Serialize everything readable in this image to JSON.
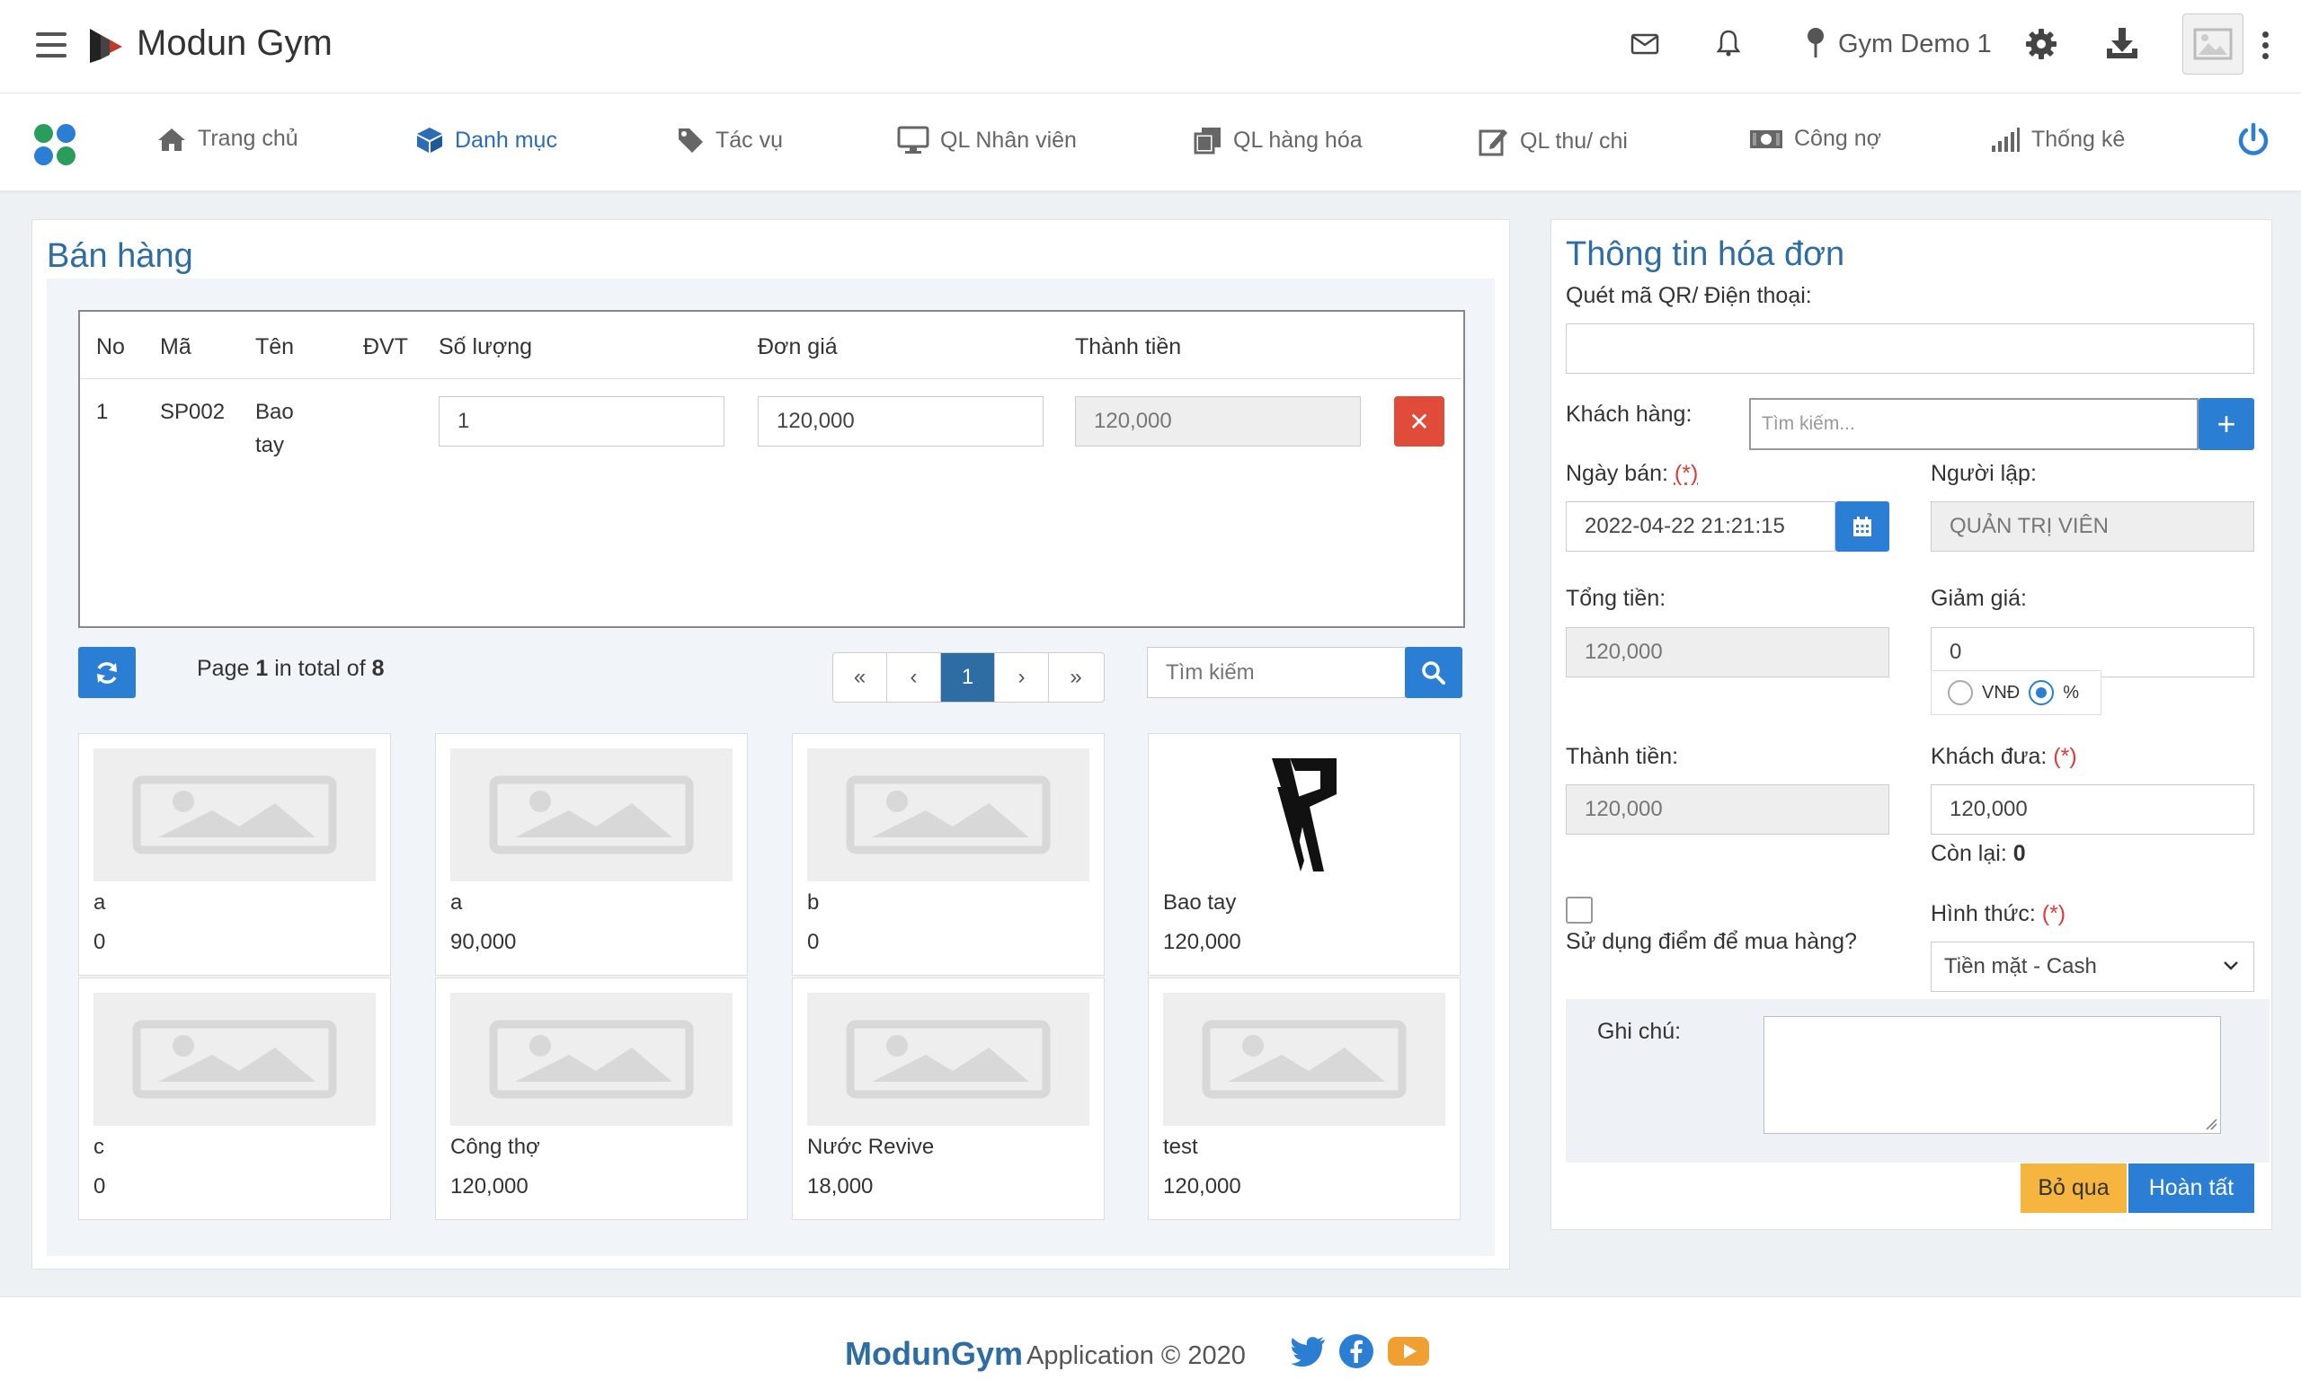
{
  "header": {
    "brand": "Modun Gym",
    "location": "Gym Demo 1"
  },
  "nav": [
    {
      "label": "Trang chủ",
      "icon": "home-icon"
    },
    {
      "label": "Danh mục",
      "icon": "cube-icon",
      "active": true
    },
    {
      "label": "Tác vụ",
      "icon": "tag-icon"
    },
    {
      "label": "QL Nhân viên",
      "icon": "monitor-icon"
    },
    {
      "label": "QL hàng hóa",
      "icon": "copy-icon"
    },
    {
      "label": "QL thu/ chi",
      "icon": "edit-icon"
    },
    {
      "label": "Công nợ",
      "icon": "money-icon"
    },
    {
      "label": "Thống kê",
      "icon": "signal-bars-icon"
    }
  ],
  "sales": {
    "title": "Bán hàng",
    "columns": [
      "No",
      "Mã",
      "Tên",
      "ĐVT",
      "Số lượng",
      "Đơn giá",
      "Thành tiền"
    ],
    "rows": [
      {
        "no": "1",
        "code": "SP002",
        "name_line1": "Bao",
        "name_line2": "tay",
        "unit": "",
        "qty": "1",
        "price": "120,000",
        "total": "120,000"
      }
    ],
    "pager": {
      "page_label": "Page",
      "page": "1",
      "in_total_label": "in total of",
      "total": "8",
      "current": "1"
    },
    "search_placeholder": "Tìm kiếm",
    "products": [
      {
        "name": "a",
        "price": "0"
      },
      {
        "name": "a",
        "price": "90,000"
      },
      {
        "name": "b",
        "price": "0"
      },
      {
        "name": "Bao tay",
        "price": "120,000"
      },
      {
        "name": "c",
        "price": "0"
      },
      {
        "name": "Công thợ",
        "price": "120,000"
      },
      {
        "name": "Nước Revive",
        "price": "18,000"
      },
      {
        "name": "test",
        "price": "120,000"
      }
    ]
  },
  "invoice": {
    "title": "Thông tin hóa đơn",
    "qr_label": "Quét mã QR/ Điện thoại:",
    "qr_value": "",
    "customer_label": "Khách hàng:",
    "customer_placeholder": "Tìm kiếm...",
    "date_label": "Ngày bán:",
    "required_mark": "(*)",
    "date_value": "2022-04-22 21:21:15",
    "creator_label": "Người lập:",
    "creator_value": "QUẢN TRỊ VIÊN",
    "total_label": "Tổng tiền:",
    "total_value": "120,000",
    "discount_label": "Giảm giá:",
    "discount_value": "0",
    "discount_unit_vnd": "VNĐ",
    "discount_unit_pct": "%",
    "discount_unit_selected": "%",
    "amount_label": "Thành tiền:",
    "amount_value": "120,000",
    "paid_label": "Khách đưa:",
    "paid_value": "120,000",
    "remain_label": "Còn lại:",
    "remain_value": "0",
    "use_points_label": "Sử dụng điểm để mua hàng?",
    "payment_label": "Hình thức:",
    "payment_value": "Tiền mặt - Cash",
    "note_label": "Ghi chú:",
    "note_value": "",
    "skip_label": "Bỏ qua",
    "done_label": "Hoàn tất"
  },
  "footer": {
    "brand": "ModunGym",
    "rest": "Application © 2020"
  },
  "colors": {
    "primary": "#2a7fd4",
    "title": "#2e6da4",
    "danger": "#e04b3a",
    "warning": "#f5b53f"
  }
}
